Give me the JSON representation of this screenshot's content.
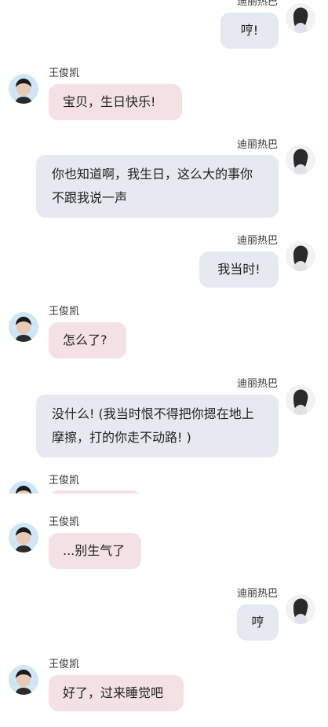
{
  "names": {
    "her": "迪丽热巴",
    "him": "王俊凯"
  },
  "messages": [
    {
      "from": "her",
      "text": "哼!"
    },
    {
      "from": "him",
      "text": "宝贝，生日快乐!"
    },
    {
      "from": "her",
      "text": "你也知道啊，我生日，这么大的事你不跟我说一声"
    },
    {
      "from": "her",
      "text": "我当时!"
    },
    {
      "from": "him",
      "text": "怎么了?"
    },
    {
      "from": "her",
      "text": "没什么! (我当时恨不得把你摁在地上摩擦，打的你走不动路! )"
    },
    {
      "from": "him",
      "text": ""
    },
    {
      "from": "him",
      "text": "...别生气了"
    },
    {
      "from": "her",
      "text": "哼"
    },
    {
      "from": "him",
      "text": "好了，过来睡觉吧"
    }
  ]
}
